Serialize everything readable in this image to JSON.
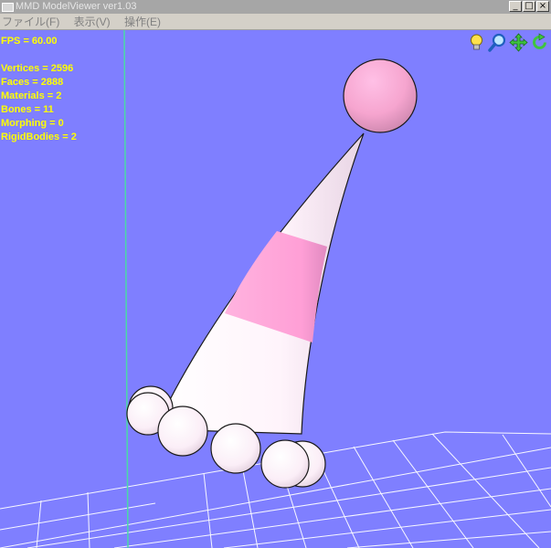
{
  "window": {
    "title": "MMD ModelViewer ver1.03"
  },
  "menu": {
    "items": [
      "ファイル(F)",
      "表示(V)",
      "操作(E)"
    ]
  },
  "stats": {
    "fps": "FPS = 60.00",
    "vertices": "Vertices = 2596",
    "faces": "Faces = 2888",
    "materials": "Materials = 2",
    "bones": "Bones = 11",
    "morphing": "Morphing = 0",
    "rigid_bodies": "RigidBodies = 2"
  },
  "toolbar": {
    "icons": [
      "lightbulb-icon",
      "zoom-icon",
      "move-icon",
      "rotate-icon"
    ]
  },
  "window_buttons": [
    "_",
    "□",
    "×"
  ],
  "colors": {
    "background": "#7f7fff",
    "grid": "#ffffff",
    "axis": "#4ad9a6",
    "model_white": "#fff0fa",
    "model_pink": "#ff9fd6",
    "stats_text": "#ffff00"
  }
}
